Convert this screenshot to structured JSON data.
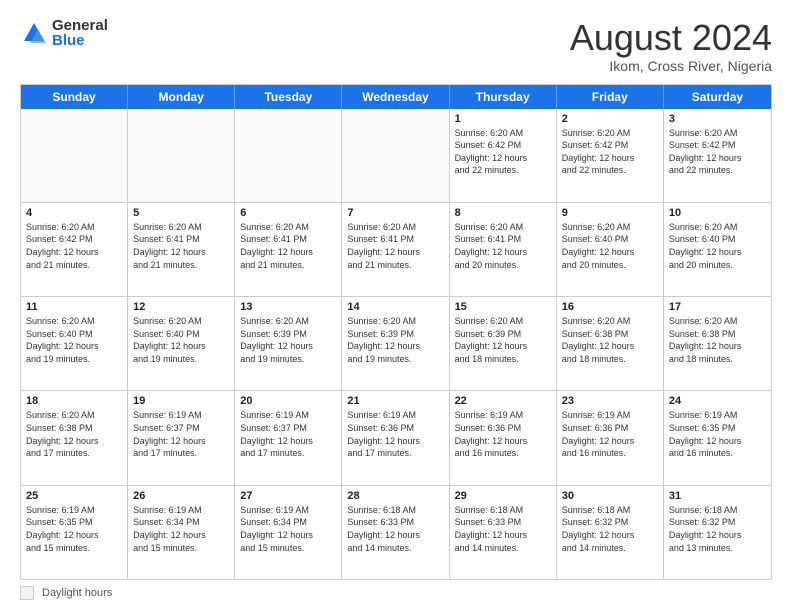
{
  "header": {
    "logo_general": "General",
    "logo_blue": "Blue",
    "month_year": "August 2024",
    "location": "Ikom, Cross River, Nigeria"
  },
  "days_of_week": [
    "Sunday",
    "Monday",
    "Tuesday",
    "Wednesday",
    "Thursday",
    "Friday",
    "Saturday"
  ],
  "weeks": [
    [
      {
        "day": "",
        "info": "",
        "empty": true
      },
      {
        "day": "",
        "info": "",
        "empty": true
      },
      {
        "day": "",
        "info": "",
        "empty": true
      },
      {
        "day": "",
        "info": "",
        "empty": true
      },
      {
        "day": "1",
        "info": "Sunrise: 6:20 AM\nSunset: 6:42 PM\nDaylight: 12 hours\nand 22 minutes.",
        "empty": false
      },
      {
        "day": "2",
        "info": "Sunrise: 6:20 AM\nSunset: 6:42 PM\nDaylight: 12 hours\nand 22 minutes.",
        "empty": false
      },
      {
        "day": "3",
        "info": "Sunrise: 6:20 AM\nSunset: 6:42 PM\nDaylight: 12 hours\nand 22 minutes.",
        "empty": false
      }
    ],
    [
      {
        "day": "4",
        "info": "Sunrise: 6:20 AM\nSunset: 6:42 PM\nDaylight: 12 hours\nand 21 minutes.",
        "empty": false
      },
      {
        "day": "5",
        "info": "Sunrise: 6:20 AM\nSunset: 6:41 PM\nDaylight: 12 hours\nand 21 minutes.",
        "empty": false
      },
      {
        "day": "6",
        "info": "Sunrise: 6:20 AM\nSunset: 6:41 PM\nDaylight: 12 hours\nand 21 minutes.",
        "empty": false
      },
      {
        "day": "7",
        "info": "Sunrise: 6:20 AM\nSunset: 6:41 PM\nDaylight: 12 hours\nand 21 minutes.",
        "empty": false
      },
      {
        "day": "8",
        "info": "Sunrise: 6:20 AM\nSunset: 6:41 PM\nDaylight: 12 hours\nand 20 minutes.",
        "empty": false
      },
      {
        "day": "9",
        "info": "Sunrise: 6:20 AM\nSunset: 6:40 PM\nDaylight: 12 hours\nand 20 minutes.",
        "empty": false
      },
      {
        "day": "10",
        "info": "Sunrise: 6:20 AM\nSunset: 6:40 PM\nDaylight: 12 hours\nand 20 minutes.",
        "empty": false
      }
    ],
    [
      {
        "day": "11",
        "info": "Sunrise: 6:20 AM\nSunset: 6:40 PM\nDaylight: 12 hours\nand 19 minutes.",
        "empty": false
      },
      {
        "day": "12",
        "info": "Sunrise: 6:20 AM\nSunset: 6:40 PM\nDaylight: 12 hours\nand 19 minutes.",
        "empty": false
      },
      {
        "day": "13",
        "info": "Sunrise: 6:20 AM\nSunset: 6:39 PM\nDaylight: 12 hours\nand 19 minutes.",
        "empty": false
      },
      {
        "day": "14",
        "info": "Sunrise: 6:20 AM\nSunset: 6:39 PM\nDaylight: 12 hours\nand 19 minutes.",
        "empty": false
      },
      {
        "day": "15",
        "info": "Sunrise: 6:20 AM\nSunset: 6:39 PM\nDaylight: 12 hours\nand 18 minutes.",
        "empty": false
      },
      {
        "day": "16",
        "info": "Sunrise: 6:20 AM\nSunset: 6:38 PM\nDaylight: 12 hours\nand 18 minutes.",
        "empty": false
      },
      {
        "day": "17",
        "info": "Sunrise: 6:20 AM\nSunset: 6:38 PM\nDaylight: 12 hours\nand 18 minutes.",
        "empty": false
      }
    ],
    [
      {
        "day": "18",
        "info": "Sunrise: 6:20 AM\nSunset: 6:38 PM\nDaylight: 12 hours\nand 17 minutes.",
        "empty": false
      },
      {
        "day": "19",
        "info": "Sunrise: 6:19 AM\nSunset: 6:37 PM\nDaylight: 12 hours\nand 17 minutes.",
        "empty": false
      },
      {
        "day": "20",
        "info": "Sunrise: 6:19 AM\nSunset: 6:37 PM\nDaylight: 12 hours\nand 17 minutes.",
        "empty": false
      },
      {
        "day": "21",
        "info": "Sunrise: 6:19 AM\nSunset: 6:36 PM\nDaylight: 12 hours\nand 17 minutes.",
        "empty": false
      },
      {
        "day": "22",
        "info": "Sunrise: 6:19 AM\nSunset: 6:36 PM\nDaylight: 12 hours\nand 16 minutes.",
        "empty": false
      },
      {
        "day": "23",
        "info": "Sunrise: 6:19 AM\nSunset: 6:36 PM\nDaylight: 12 hours\nand 16 minutes.",
        "empty": false
      },
      {
        "day": "24",
        "info": "Sunrise: 6:19 AM\nSunset: 6:35 PM\nDaylight: 12 hours\nand 16 minutes.",
        "empty": false
      }
    ],
    [
      {
        "day": "25",
        "info": "Sunrise: 6:19 AM\nSunset: 6:35 PM\nDaylight: 12 hours\nand 15 minutes.",
        "empty": false
      },
      {
        "day": "26",
        "info": "Sunrise: 6:19 AM\nSunset: 6:34 PM\nDaylight: 12 hours\nand 15 minutes.",
        "empty": false
      },
      {
        "day": "27",
        "info": "Sunrise: 6:19 AM\nSunset: 6:34 PM\nDaylight: 12 hours\nand 15 minutes.",
        "empty": false
      },
      {
        "day": "28",
        "info": "Sunrise: 6:18 AM\nSunset: 6:33 PM\nDaylight: 12 hours\nand 14 minutes.",
        "empty": false
      },
      {
        "day": "29",
        "info": "Sunrise: 6:18 AM\nSunset: 6:33 PM\nDaylight: 12 hours\nand 14 minutes.",
        "empty": false
      },
      {
        "day": "30",
        "info": "Sunrise: 6:18 AM\nSunset: 6:32 PM\nDaylight: 12 hours\nand 14 minutes.",
        "empty": false
      },
      {
        "day": "31",
        "info": "Sunrise: 6:18 AM\nSunset: 6:32 PM\nDaylight: 12 hours\nand 13 minutes.",
        "empty": false
      }
    ]
  ],
  "footer": {
    "shaded_label": "Daylight hours"
  }
}
